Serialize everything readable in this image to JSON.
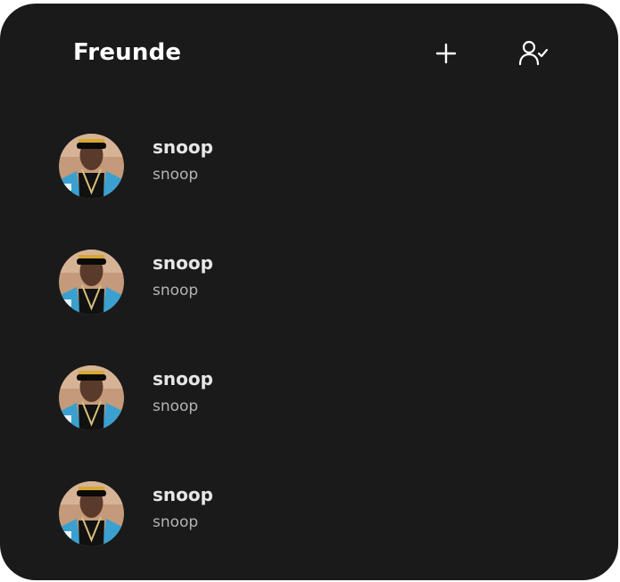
{
  "header": {
    "title": "Freunde",
    "add_icon": "plus-icon",
    "requests_icon": "user-check-icon"
  },
  "friends": [
    {
      "name": "snoop",
      "username": "snoop",
      "avatar": "avatar-photo"
    },
    {
      "name": "snoop",
      "username": "snoop",
      "avatar": "avatar-photo"
    },
    {
      "name": "snoop",
      "username": "snoop",
      "avatar": "avatar-photo"
    },
    {
      "name": "snoop",
      "username": "snoop",
      "avatar": "avatar-photo"
    }
  ],
  "colors": {
    "background": "#1a1a1a",
    "title": "#ffffff",
    "name": "#e6e6e6",
    "handle": "#b4b4b4"
  }
}
